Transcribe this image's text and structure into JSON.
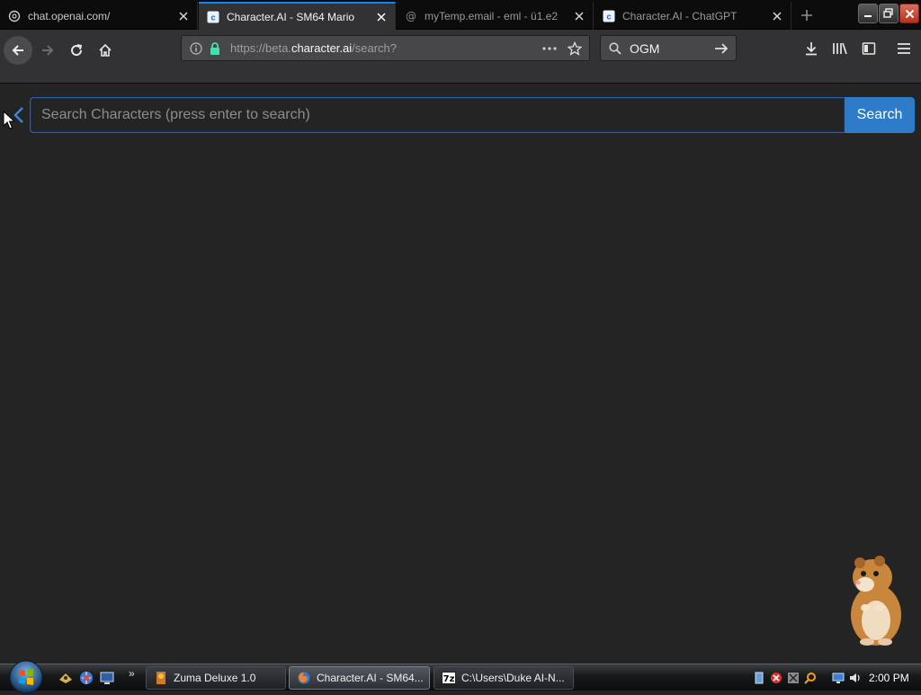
{
  "browser": {
    "tabs": [
      {
        "label": "chat.openai.com/",
        "icon": "openai-icon",
        "active": false
      },
      {
        "label": "Character.AI - SM64 Mario",
        "icon": "character-ai-icon",
        "active": true
      },
      {
        "label": "myTemp.email - eml - ü1.e2",
        "icon": "at-sign-icon",
        "active": false
      },
      {
        "label": "Character.AI - ChatGPT",
        "icon": "character-ai-icon",
        "active": false
      }
    ],
    "url": {
      "prefix": "https://beta.",
      "host": "character.ai",
      "path": "/search?"
    },
    "search_box_value": "OGM"
  },
  "page": {
    "search_placeholder": "Search Characters (press enter to search)",
    "search_value": "",
    "search_button_label": "Search"
  },
  "taskbar": {
    "tasks": [
      {
        "label": "Zuma Deluxe 1.0",
        "icon": "zuma-icon",
        "active": false
      },
      {
        "label": "Character.AI - SM64...",
        "icon": "firefox-icon",
        "active": true
      },
      {
        "label": "C:\\Users\\Duke AI-N...",
        "icon": "7zip-icon",
        "active": false
      }
    ],
    "clock": "2:00 PM"
  },
  "colors": {
    "page_bg": "#242424",
    "accent": "#2e7bc9",
    "tab_active_indicator": "#0a84ff",
    "lock_green": "#3fe1b0"
  }
}
